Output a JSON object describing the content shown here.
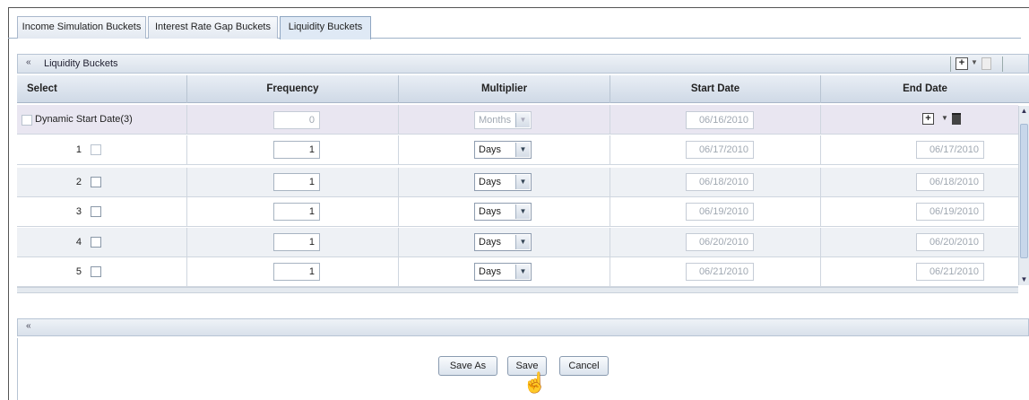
{
  "tabs": [
    {
      "label": "Income Simulation Buckets"
    },
    {
      "label": "Interest Rate Gap Buckets"
    },
    {
      "label": "Liquidity Buckets"
    }
  ],
  "section": {
    "title": "Liquidity Buckets",
    "collapse_glyph": "«"
  },
  "columns": [
    "Select",
    "Frequency",
    "Multiplier",
    "Start Date",
    "End Date"
  ],
  "dynamic_row": {
    "label": "Dynamic Start Date(3)",
    "frequency": "0",
    "multiplier": "Months",
    "start_date": "06/16/2010"
  },
  "rows": [
    {
      "num": "1",
      "frequency": "1",
      "multiplier": "Days",
      "start_date": "06/17/2010",
      "end_date": "06/17/2010"
    },
    {
      "num": "2",
      "frequency": "1",
      "multiplier": "Days",
      "start_date": "06/18/2010",
      "end_date": "06/18/2010"
    },
    {
      "num": "3",
      "frequency": "1",
      "multiplier": "Days",
      "start_date": "06/19/2010",
      "end_date": "06/19/2010"
    },
    {
      "num": "4",
      "frequency": "1",
      "multiplier": "Days",
      "start_date": "06/20/2010",
      "end_date": "06/20/2010"
    },
    {
      "num": "5",
      "frequency": "1",
      "multiplier": "Days",
      "start_date": "06/21/2010",
      "end_date": "06/21/2010"
    }
  ],
  "lower": {
    "collapse_glyph": "«"
  },
  "buttons": {
    "save_as": "Save As",
    "save": "Save",
    "cancel": "Cancel"
  },
  "icons": {
    "add": "add-row-icon",
    "delete": "delete-icon",
    "caret": "chevron-down-icon"
  }
}
